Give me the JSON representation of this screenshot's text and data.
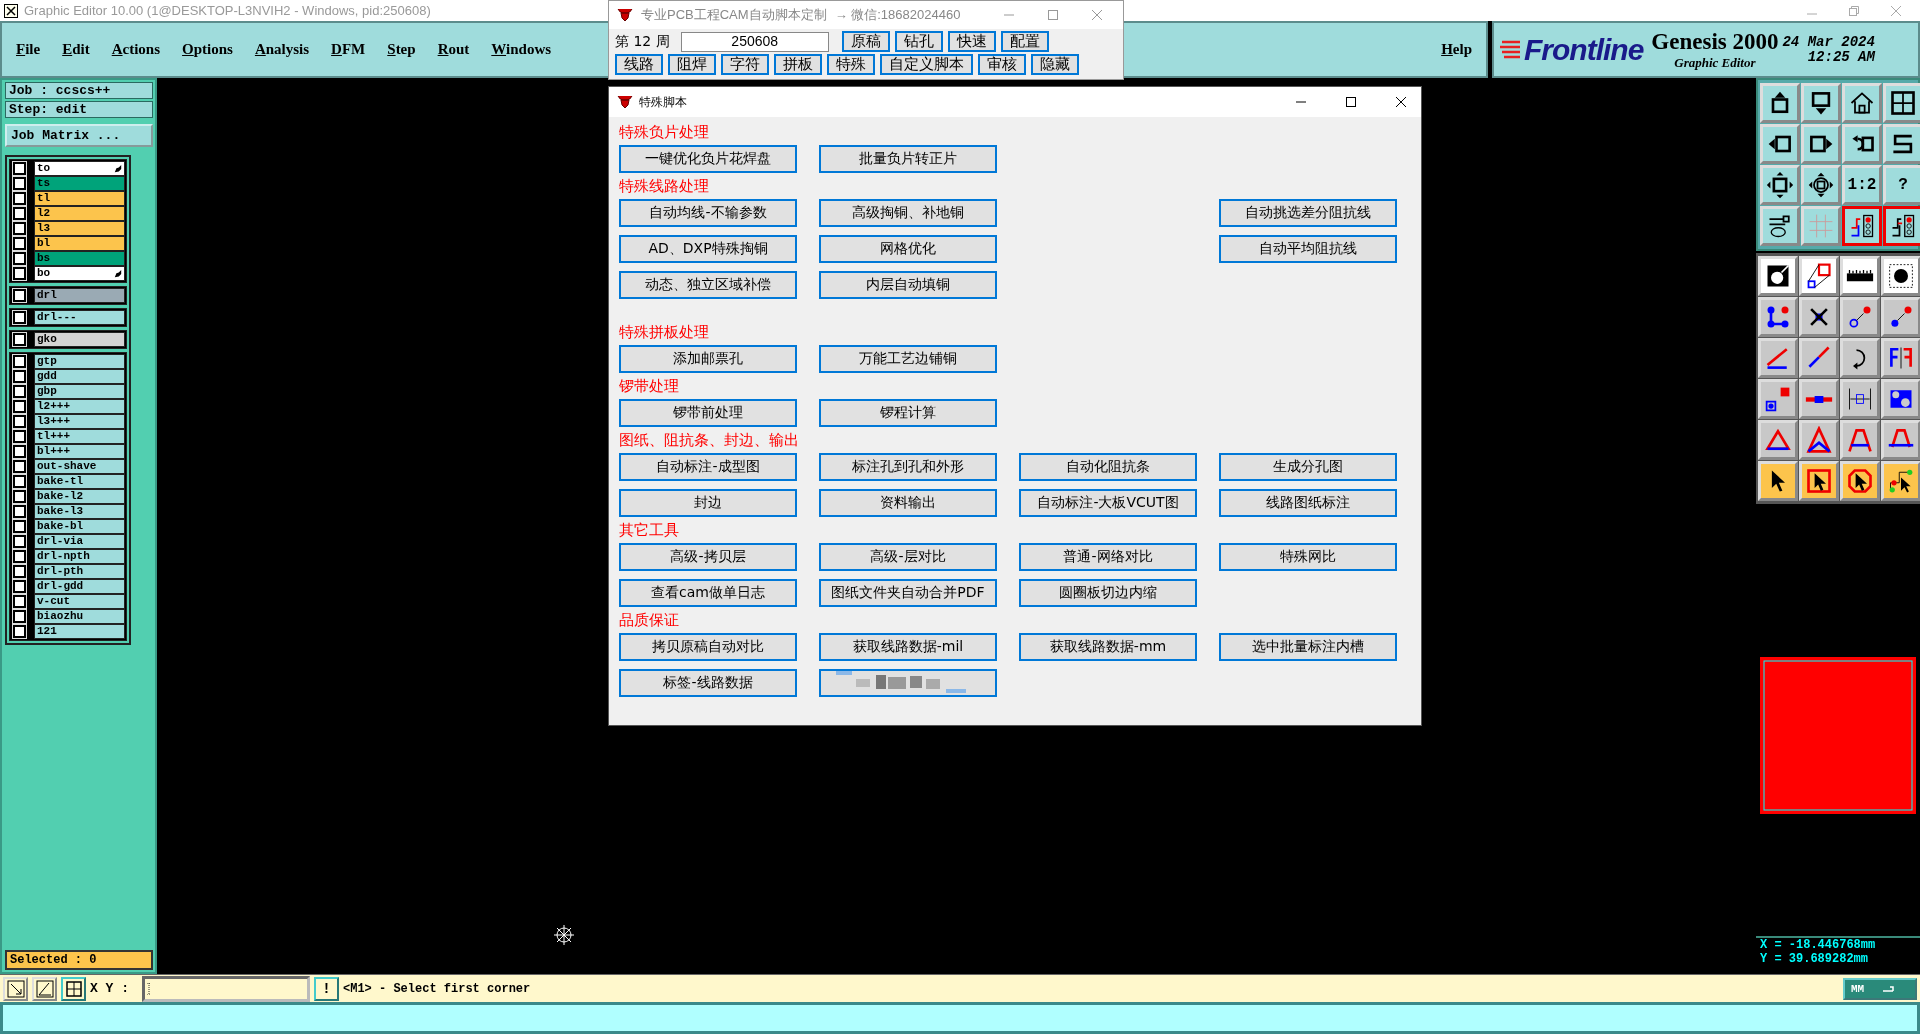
{
  "window": {
    "title": "Graphic Editor 10.00 (1@DESKTOP-L3NVIH2 - Windows, pid:250608)"
  },
  "menu": {
    "items": [
      "File",
      "Edit",
      "Actions",
      "Options",
      "Analysis",
      "DFM",
      "Step",
      "Rout",
      "Windows"
    ],
    "help": "Help"
  },
  "brand": {
    "logo": "Frontline",
    "product": "Genesis 2000",
    "subtitle": "Graphic Editor",
    "date": "24 Mar 2024",
    "time": "12:25 AM"
  },
  "job_panel": {
    "job": "Job : ccscs++",
    "step": "Step: edit",
    "matrix_button": "Job Matrix ...",
    "selected": "Selected : 0"
  },
  "layer_groups": [
    {
      "layers": [
        {
          "name": "to",
          "color": "#ffffff",
          "checked": false,
          "side_icon": true
        },
        {
          "name": "ts",
          "color": "#00a37a",
          "checked": false,
          "side_icon": false
        },
        {
          "name": "tl",
          "color": "#fcc44c",
          "checked": false,
          "side_icon": false
        },
        {
          "name": "l2",
          "color": "#fcc44c",
          "checked": false,
          "side_icon": false
        },
        {
          "name": "l3",
          "color": "#fcc44c",
          "checked": false,
          "side_icon": false
        },
        {
          "name": "bl",
          "color": "#fcc44c",
          "checked": false,
          "side_icon": false
        },
        {
          "name": "bs",
          "color": "#00a37a",
          "checked": false,
          "side_icon": false
        },
        {
          "name": "bo",
          "color": "#ffffff",
          "checked": false,
          "side_icon": true
        }
      ]
    },
    {
      "layers": [
        {
          "name": "drl",
          "color": "#9aaab4",
          "checked": false,
          "side_icon": false
        }
      ]
    },
    {
      "layers": [
        {
          "name": "drl---",
          "color": "#9fdcdc",
          "checked": false,
          "side_icon": false
        }
      ]
    },
    {
      "layers": [
        {
          "name": "gko",
          "color": "#d4d4d4",
          "checked": false,
          "side_icon": false
        }
      ]
    },
    {
      "layers": [
        {
          "name": "gtp",
          "color": "#9fdcdc",
          "checked": false,
          "side_icon": false
        },
        {
          "name": "gdd",
          "color": "#9fdcdc",
          "checked": false,
          "side_icon": false
        },
        {
          "name": "gbp",
          "color": "#9fdcdc",
          "checked": false,
          "side_icon": false
        },
        {
          "name": "l2+++",
          "color": "#9fdcdc",
          "checked": false,
          "side_icon": false
        },
        {
          "name": "l3+++",
          "color": "#9fdcdc",
          "checked": false,
          "side_icon": false
        },
        {
          "name": "tl+++",
          "color": "#9fdcdc",
          "checked": false,
          "side_icon": false
        },
        {
          "name": "bl+++",
          "color": "#9fdcdc",
          "checked": false,
          "side_icon": false
        },
        {
          "name": "out-shave",
          "color": "#9fdcdc",
          "checked": false,
          "side_icon": false
        },
        {
          "name": "bake-tl",
          "color": "#9fdcdc",
          "checked": false,
          "side_icon": false
        },
        {
          "name": "bake-l2",
          "color": "#9fdcdc",
          "checked": false,
          "side_icon": false
        },
        {
          "name": "bake-l3",
          "color": "#9fdcdc",
          "checked": false,
          "side_icon": false
        },
        {
          "name": "bake-bl",
          "color": "#9fdcdc",
          "checked": false,
          "side_icon": false
        },
        {
          "name": "drl-via",
          "color": "#9fdcdc",
          "checked": false,
          "side_icon": false
        },
        {
          "name": "drl-npth",
          "color": "#9fdcdc",
          "checked": false,
          "side_icon": false
        },
        {
          "name": "drl-pth",
          "color": "#9fdcdc",
          "checked": false,
          "side_icon": false
        },
        {
          "name": "drl-gdd",
          "color": "#9fdcdc",
          "checked": false,
          "side_icon": false
        },
        {
          "name": "v-cut",
          "color": "#9fdcdc",
          "checked": false,
          "side_icon": false
        },
        {
          "name": "biaozhu",
          "color": "#9fdcdc",
          "checked": false,
          "side_icon": false
        },
        {
          "name": "121",
          "color": "#9fdcdc",
          "checked": false,
          "side_icon": false
        }
      ]
    }
  ],
  "tool_labels": [
    "1:2",
    "?"
  ],
  "coordinates": {
    "x": "X = -18.446768mm",
    "y": "Y = 39.689282mm"
  },
  "command_bar": {
    "xy_label": "X Y :",
    "alert_button": "!",
    "message": "<M1> - Select first corner",
    "units": "MM"
  },
  "script_toolbar": {
    "title": "专业PCB工程CAM自动脚本定制",
    "contact": "→ 微信:18682024460",
    "week_label": "第 12 周",
    "week_value": "250608",
    "row_1": [
      "原稿",
      "钻孔",
      "快速",
      "配置"
    ],
    "row_2": [
      "线路",
      "阻焊",
      "字符",
      "拼板",
      "特殊",
      "自定义脚本",
      "审核",
      "隐藏"
    ]
  },
  "dialog": {
    "title": "特殊脚本",
    "sections": [
      {
        "heading": "特殊负片处理",
        "rows": [
          [
            {
              "kind": "button",
              "label": "一键优化负片花焊盘"
            },
            {
              "kind": "button",
              "label": "批量负片转正片"
            }
          ]
        ]
      },
      {
        "heading": "特殊线路处理",
        "rows": [
          [
            {
              "kind": "button",
              "label": "自动均线-不输参数"
            },
            {
              "kind": "button",
              "label": "高级掏铜、补地铜"
            },
            {
              "kind": "empty"
            },
            {
              "kind": "button",
              "label": "自动挑选差分阻抗线"
            }
          ],
          [
            {
              "kind": "button",
              "label": "AD、DXP特殊掏铜"
            },
            {
              "kind": "button",
              "label": "网格优化"
            },
            {
              "kind": "empty"
            },
            {
              "kind": "button",
              "label": "自动平均阻抗线"
            }
          ],
          [
            {
              "kind": "button",
              "label": "动态、独立区域补偿"
            },
            {
              "kind": "button",
              "label": "内层自动填铜"
            }
          ]
        ]
      },
      {
        "heading": "特殊拼板处理",
        "rows": [
          [
            {
              "kind": "button",
              "label": "添加邮票孔"
            },
            {
              "kind": "button",
              "label": "万能工艺边铺铜"
            }
          ]
        ]
      },
      {
        "heading": "锣带处理",
        "rows": [
          [
            {
              "kind": "button",
              "label": "锣带前处理"
            },
            {
              "kind": "button",
              "label": "锣程计算"
            }
          ]
        ]
      },
      {
        "heading": "图纸、阻抗条、封边、输出",
        "rows": [
          [
            {
              "kind": "button",
              "label": "自动标注-成型图"
            },
            {
              "kind": "button",
              "label": "标注孔到孔和外形"
            },
            {
              "kind": "button",
              "label": "自动化阻抗条"
            },
            {
              "kind": "button",
              "label": "生成分孔图"
            }
          ],
          [
            {
              "kind": "button",
              "label": "封边"
            },
            {
              "kind": "button",
              "label": "资料输出"
            },
            {
              "kind": "button",
              "label": "自动标注-大板VCUT图"
            },
            {
              "kind": "button",
              "label": "线路图纸标注"
            }
          ]
        ]
      },
      {
        "heading": "其它工具",
        "rows": [
          [
            {
              "kind": "button",
              "label": "高级-拷贝层"
            },
            {
              "kind": "button",
              "label": "高级-层对比"
            },
            {
              "kind": "button",
              "label": "普通-网络对比"
            },
            {
              "kind": "button",
              "label": "特殊网比"
            }
          ],
          [
            {
              "kind": "button",
              "label": "查看cam做单日志"
            },
            {
              "kind": "button",
              "label": "图纸文件夹自动合并PDF"
            },
            {
              "kind": "button",
              "label": "圆圈板切边内缩"
            }
          ]
        ]
      },
      {
        "heading": "品质保证",
        "rows": [
          [
            {
              "kind": "button",
              "label": "拷贝原稿自动对比"
            },
            {
              "kind": "button",
              "label": "获取线路数据-mil"
            },
            {
              "kind": "button",
              "label": "获取线路数据-mm"
            },
            {
              "kind": "button",
              "label": "选中批量标注内槽"
            }
          ],
          [
            {
              "kind": "button",
              "label": "标签-线路数据"
            },
            {
              "kind": "redacted"
            }
          ]
        ]
      }
    ]
  }
}
